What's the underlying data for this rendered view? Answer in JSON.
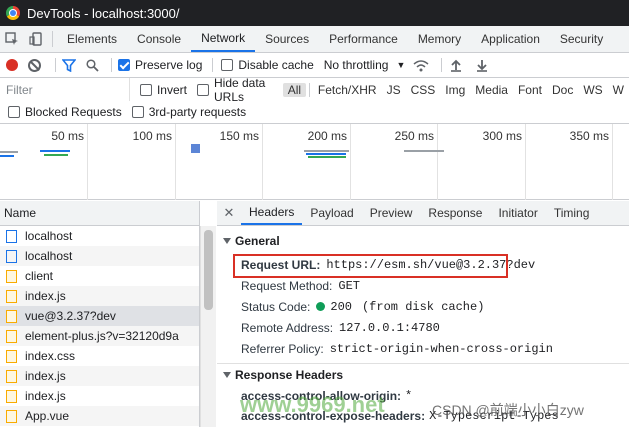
{
  "window": {
    "title": "DevTools - localhost:3000/"
  },
  "tabs": [
    "Elements",
    "Console",
    "Network",
    "Sources",
    "Performance",
    "Memory",
    "Application",
    "Security"
  ],
  "active_tab": "Network",
  "toolbar": {
    "preserve_log": "Preserve log",
    "disable_cache": "Disable cache",
    "throttling": "No throttling"
  },
  "filter": {
    "placeholder": "Filter",
    "invert": "Invert",
    "hide_data_urls": "Hide data URLs",
    "types": [
      "All",
      "Fetch/XHR",
      "JS",
      "CSS",
      "Img",
      "Media",
      "Font",
      "Doc",
      "WS",
      "W"
    ]
  },
  "blockbar": {
    "blocked": "Blocked Requests",
    "third_party": "3rd-party requests"
  },
  "timeline": {
    "ticks": [
      "50 ms",
      "100 ms",
      "150 ms",
      "200 ms",
      "250 ms",
      "300 ms",
      "350 ms"
    ]
  },
  "requests": {
    "header": "Name",
    "items": [
      {
        "name": "localhost",
        "type": "doc"
      },
      {
        "name": "localhost",
        "type": "doc"
      },
      {
        "name": "client",
        "type": "script"
      },
      {
        "name": "index.js",
        "type": "script"
      },
      {
        "name": "vue@3.2.37?dev",
        "type": "script"
      },
      {
        "name": "element-plus.js?v=32120d9a",
        "type": "script"
      },
      {
        "name": "index.css",
        "type": "script"
      },
      {
        "name": "index.js",
        "type": "script"
      },
      {
        "name": "index.js",
        "type": "script"
      },
      {
        "name": "App.vue",
        "type": "script"
      }
    ]
  },
  "details": {
    "close": "✕",
    "tabs": [
      "Headers",
      "Payload",
      "Preview",
      "Response",
      "Initiator",
      "Timing"
    ],
    "general": {
      "title": "General",
      "request_url_key": "Request URL:",
      "request_url": "https://esm.sh/vue@3.2.37?dev",
      "method_key": "Request Method:",
      "method": "GET",
      "status_key": "Status Code:",
      "status": "200",
      "status_note": "(from disk cache)",
      "remote_key": "Remote Address:",
      "remote": "127.0.0.1:4780",
      "referrer_key": "Referrer Policy:",
      "referrer": "strict-origin-when-cross-origin"
    },
    "response_headers": {
      "title": "Response Headers",
      "h1_key": "access-control-allow-origin:",
      "h1_val": "*",
      "h2_key": "access-control-expose-headers:",
      "h2_val": "X-Typescript-Types"
    }
  },
  "watermark": {
    "site": "www.9969.net",
    "credit": "CSDN @前端小小白zyw"
  }
}
